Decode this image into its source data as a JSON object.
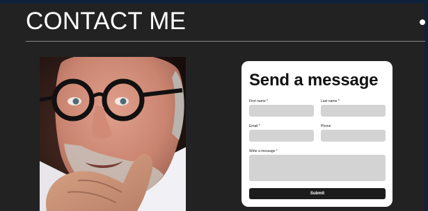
{
  "page": {
    "title": "CONTACT ME"
  },
  "portrait": {
    "alt": "Portrait of a man with round glasses"
  },
  "form": {
    "heading": "Send a message",
    "first_name_label": "First name *",
    "last_name_label": "Last name *",
    "email_label": "Email *",
    "phone_label": "Phone",
    "message_label": "Write a message *",
    "first_name_value": "",
    "last_name_value": "",
    "email_value": "",
    "phone_value": "",
    "message_value": "",
    "submit_label": "Submit"
  },
  "colors": {
    "background": "#222222",
    "accent_strip": "#10223a",
    "card": "#ffffff",
    "field": "#d3d3d3",
    "button": "#1c1c1c"
  }
}
